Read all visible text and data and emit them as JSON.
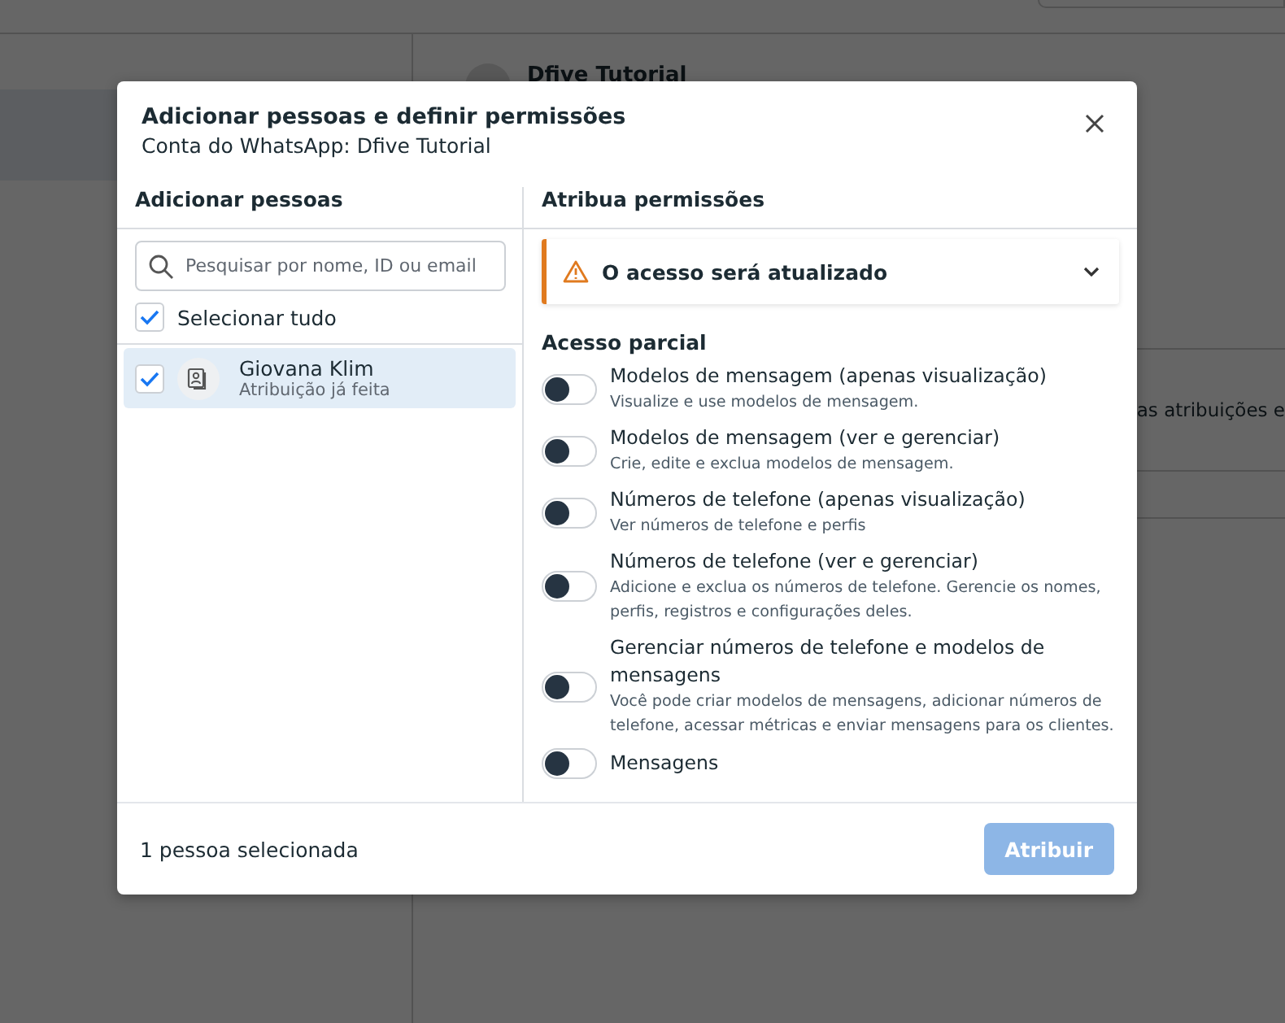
{
  "background": {
    "account_title": "Dfive Tutorial",
    "row_text": "as atribuições e"
  },
  "dialog": {
    "title": "Adicionar pessoas e definir permissões",
    "subtitle": "Conta do WhatsApp: Dfive Tutorial",
    "left": {
      "heading": "Adicionar pessoas",
      "search": {
        "placeholder": "Pesquisar por nome, ID ou email"
      },
      "select_all": {
        "label": "Selecionar tudo",
        "checked": true
      },
      "people": [
        {
          "name": "Giovana Klim",
          "note": "Atribuição já feita",
          "checked": true,
          "selected": true
        }
      ]
    },
    "right": {
      "heading": "Atribua permissões",
      "alert": {
        "text": "O acesso será atualizado",
        "expanded": false
      },
      "section": "Acesso parcial",
      "permissions": [
        {
          "title": "Modelos de mensagem (apenas visualização)",
          "description": "Visualize e use modelos de mensagem.",
          "on": false
        },
        {
          "title": "Modelos de mensagem (ver e gerenciar)",
          "description": "Crie, edite e exclua modelos de mensagem.",
          "on": false
        },
        {
          "title": "Números de telefone (apenas visualização)",
          "description": "Ver números de telefone e perfis",
          "on": false
        },
        {
          "title": "Números de telefone (ver e gerenciar)",
          "description": "Adicione e exclua os números de telefone. Gerencie os nomes, perfis, registros e configurações deles.",
          "on": false
        },
        {
          "title": "Gerenciar números de telefone e modelos de mensagens",
          "description": "Você pode criar modelos de mensagens, adicionar números de telefone, acessar métricas e enviar mensagens para os clientes.",
          "on": false
        },
        {
          "title": "Mensagens",
          "on": false
        }
      ]
    },
    "footer": {
      "count": "1 pessoa selecionada",
      "button": {
        "label": "Atribuir",
        "disabled": true
      }
    }
  }
}
